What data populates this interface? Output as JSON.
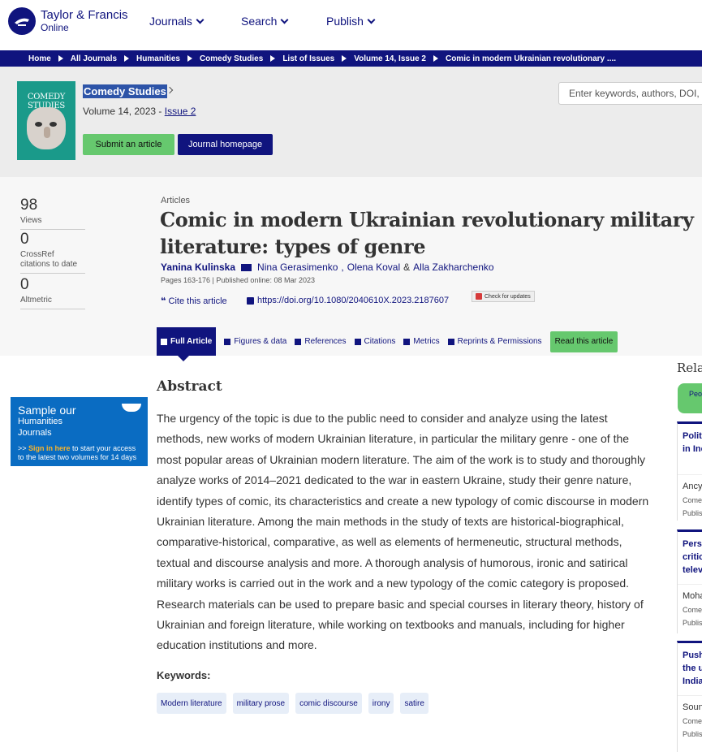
{
  "header": {
    "logo_line1": "Taylor & Francis",
    "logo_line2": "Online",
    "nav": [
      {
        "label": "Journals"
      },
      {
        "label": "Search"
      },
      {
        "label": "Publish"
      }
    ]
  },
  "breadcrumb": [
    "Home",
    "All Journals",
    "Humanities",
    "Comedy Studies",
    "List of Issues",
    "Volume 14, Issue 2",
    "Comic in modern Ukrainian revolutionary ...."
  ],
  "journal": {
    "cover_title": "COMEDY STUDIES",
    "title": "Comedy Studies",
    "volume_text": "Volume 14, 2023 - ",
    "issue_link": "Issue 2",
    "submit_label": "Submit an article",
    "homepage_label": "Journal homepage",
    "search_placeholder": "Enter keywords, authors, DOI, etc"
  },
  "metrics": [
    {
      "value": "98",
      "label": "Views"
    },
    {
      "value": "0",
      "label": "CrossRef citations to date"
    },
    {
      "value": "0",
      "label": "Altmetric"
    }
  ],
  "article": {
    "type": "Articles",
    "title": "Comic in modern Ukrainian revolutionary military literature: types of genre",
    "authors": [
      "Yanina Kulinska",
      "Nina Gerasimenko",
      "Olena Koval",
      "Alla Zakharchenko"
    ],
    "author_sep_comma": ",",
    "author_sep_and": "&",
    "meta": "Pages 163-176 | Published online: 08 Mar 2023",
    "cite_label": "Cite this article",
    "doi": "https://doi.org/10.1080/2040610X.2023.2187607",
    "check_label": "Check for updates"
  },
  "tabs": [
    {
      "label": "Full Article"
    },
    {
      "label": "Figures & data"
    },
    {
      "label": "References"
    },
    {
      "label": "Citations"
    },
    {
      "label": "Metrics"
    },
    {
      "label": "Reprints & Permissions"
    },
    {
      "label": "Read this article"
    }
  ],
  "promo": {
    "line1": "Sample our",
    "line2": "Humanities",
    "line3": "Journals",
    "sign_in": "Sign in here",
    "rest": " to start your access to the latest two volumes for 14 days",
    "arrows": ">>"
  },
  "abstract": {
    "heading": "Abstract",
    "text": "The urgency of the topic is due to the public need to consider and analyze using the latest methods, new works of modern Ukrainian literature, in particular the military genre - one of the most popular areas of Ukrainian modern literature. The aim of the work is to study and thoroughly analyze works of 2014–2021 dedicated to the war in eastern Ukraine, study their genre nature, identify types of comic, its characteristics and create a new typology of comic discourse in modern Ukrainian literature. Among the main methods in the study of texts are historical-biographical, comparative-historical, comparative, as well as elements of hermeneutic, structural methods, textual and discourse analysis and more. A thorough analysis of humorous, ironic and satirical military works is carried out in the work and a new typology of the comic category is proposed. Research materials can be used to prepare basic and special courses in literary theory, history of Ukrainian and foreign literature, while working on textbooks and manuals, including for higher education institutions and more.",
    "keywords_heading": "Keywords:",
    "keywords": [
      "Modern literature",
      "military prose",
      "comic discourse",
      "irony",
      "satire"
    ]
  },
  "sidebar": {
    "heading": "Rela",
    "tab_label": "Peo",
    "cards": [
      {
        "title1": "Polit",
        "title2": "in Inc",
        "title3": "",
        "author": "Ancy",
        "meta1": "Come",
        "meta2": "Publis"
      },
      {
        "title1": "Pers",
        "title2": "critic",
        "title3": "telev",
        "author": "Moha",
        "meta1": "Come",
        "meta2": "Publis"
      },
      {
        "title1": "Push",
        "title2": "the u",
        "title3": "India",
        "author": "Soun",
        "meta1": "Come",
        "meta2": "Publis"
      }
    ]
  },
  "colors": {
    "brand_navy": "#10147e",
    "accent_green": "#66c86e",
    "promo_blue": "#0a6cc2"
  }
}
